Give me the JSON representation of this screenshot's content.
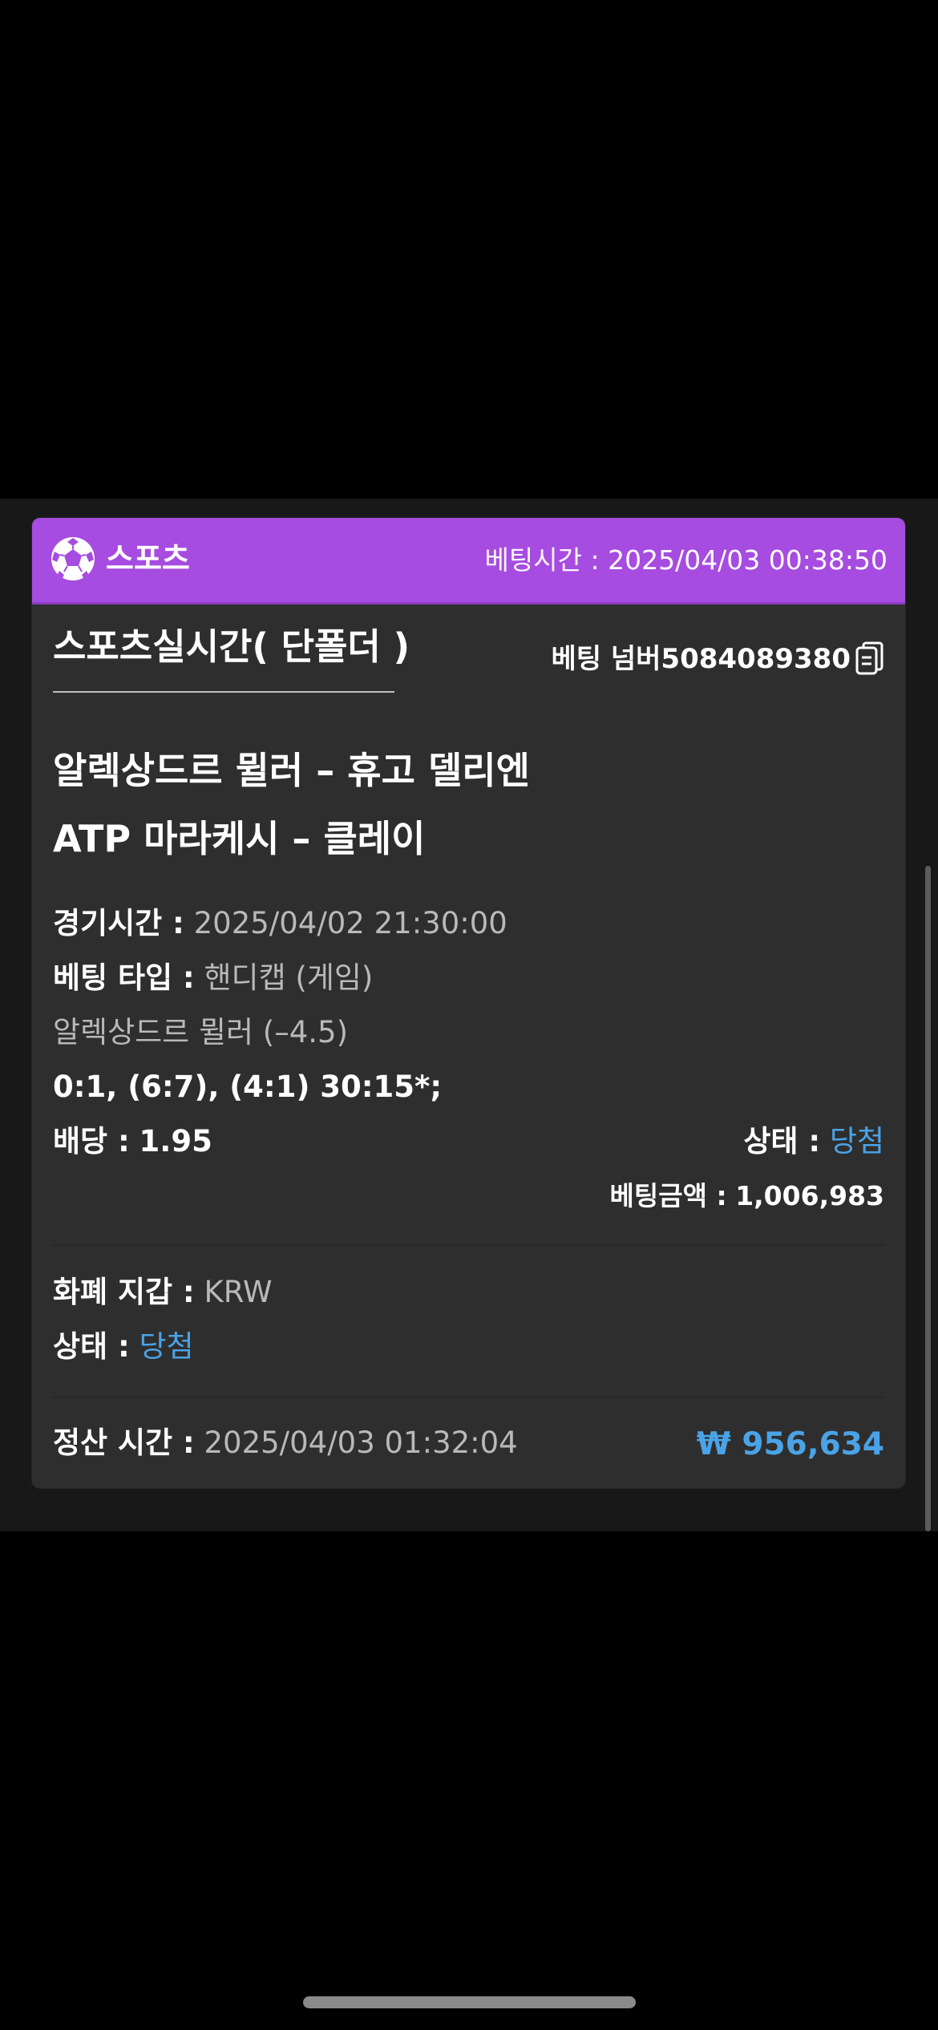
{
  "header": {
    "brand": "스포츠",
    "bet_time_label": "베팅시간 :",
    "bet_time_value": "2025/04/03 00:38:50"
  },
  "card": {
    "subtitle": "스포츠실시간( 단폴더 )",
    "bet_number_label": "베팅 넘버",
    "bet_number_value": "5084089380",
    "match_title": "알렉상드르 뮐러 – 휴고 델리엔",
    "league": "ATP 마라케시 – 클레이",
    "game_time_label": "경기시간 :",
    "game_time_value": "2025/04/02 21:30:00",
    "bet_type_label": "베팅 타입 :",
    "bet_type_value": "핸디캡 (게임)",
    "selection": "알렉상드르 뮐러 (–4.5)",
    "score": "0:1, (6:7), (4:1) 30:15*;",
    "odds_label": "배당 :",
    "odds_value": "1.95",
    "status_label": "상태 :",
    "status_value": "당첨",
    "bet_amount_label": "베팅금액 :",
    "bet_amount_value": "1,006,983",
    "currency_label": "화폐 지갑 :",
    "currency_value": "KRW",
    "status2_label": "상태 :",
    "status2_value": "당첨",
    "settle_time_label": "정산 시간 :",
    "settle_time_value": "2025/04/03 01:32:04",
    "payout": "₩ 956,634"
  },
  "colors": {
    "header_bg": "#a64ce0",
    "card_bg": "#2e2e2e",
    "accent_blue": "#4aa3e6",
    "panel_bg": "#181818"
  },
  "icons": {
    "header": "soccer-ball-icon",
    "copy": "copy-icon"
  }
}
